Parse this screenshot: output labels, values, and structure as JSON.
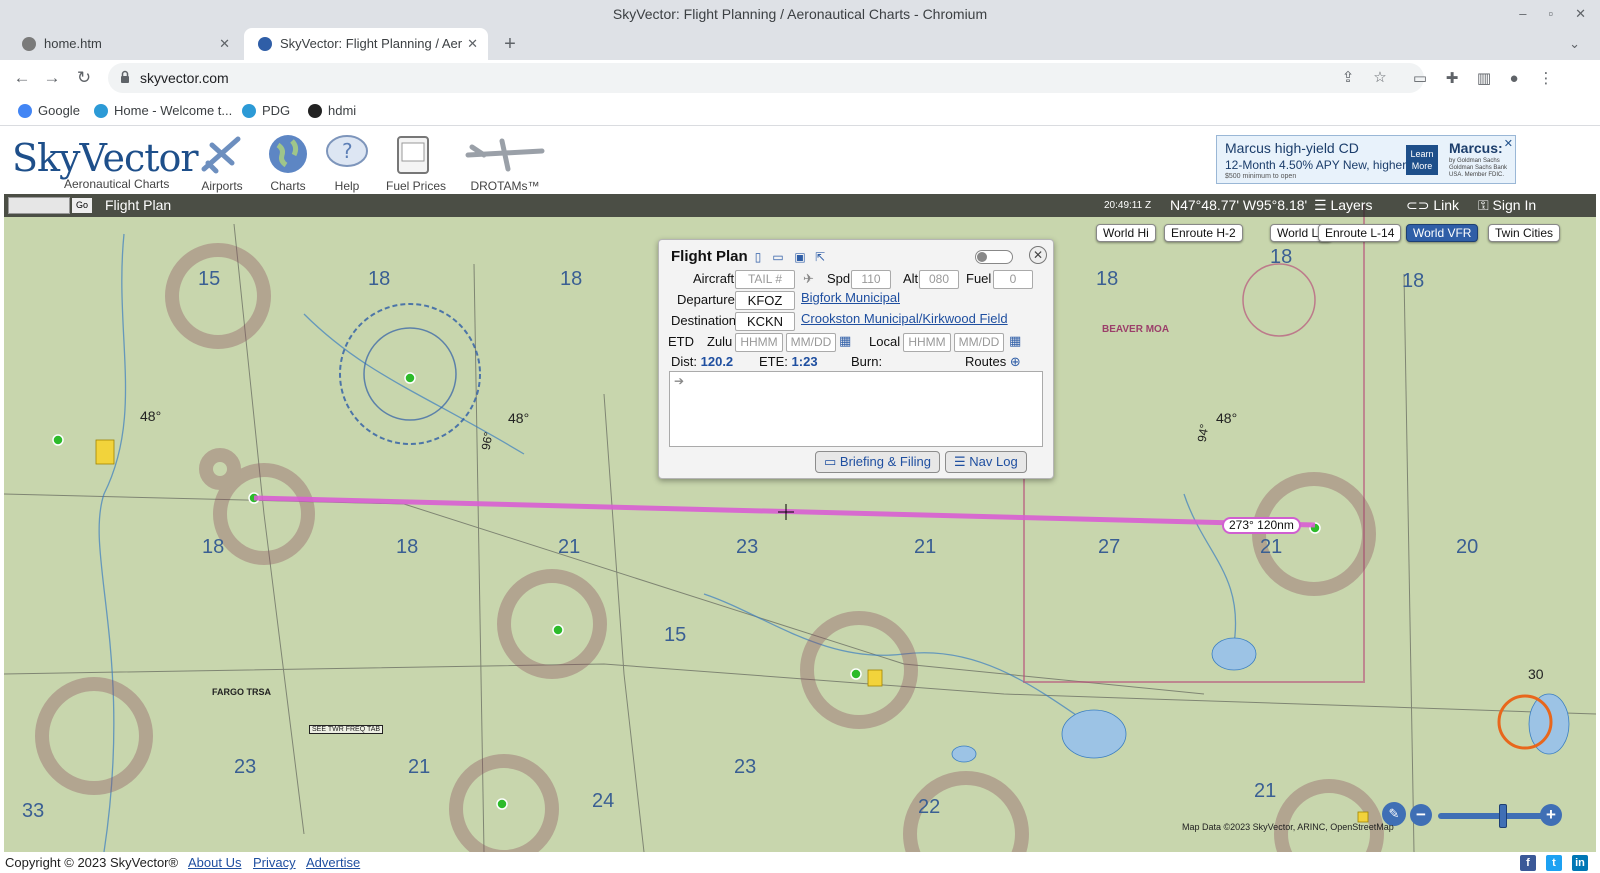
{
  "window": {
    "title": "SkyVector: Flight Planning / Aeronautical Charts - Chromium"
  },
  "tabs": [
    {
      "label": "home.htm"
    },
    {
      "label": "SkyVector: Flight Planning / Aer"
    }
  ],
  "address": {
    "url": "skyvector.com"
  },
  "bookmarks": [
    {
      "label": "Google"
    },
    {
      "label": "Home - Welcome t..."
    },
    {
      "label": "PDG"
    },
    {
      "label": "hdmi"
    }
  ],
  "site": {
    "logo": "SkyVector",
    "logo_tagline": "Aeronautical Charts",
    "nav": [
      {
        "label": "Airports",
        "icon": "airplane-icon"
      },
      {
        "label": "Charts",
        "icon": "globe-icon"
      },
      {
        "label": "Help",
        "icon": "help-icon"
      },
      {
        "label": "Fuel Prices",
        "icon": "fuel-icon"
      },
      {
        "label": "DROTAMs™",
        "icon": "drone-icon"
      }
    ],
    "ad": {
      "brand": "Marcus high-yield CD",
      "apy": "12-Month 4.50% APY New, higher rate!",
      "minimum": "$500 minimum to open",
      "cta": "Learn More",
      "logo": "Marcus:",
      "logo_sub": "by Goldman Sachs Goldman Sachs Bank USA. Member FDIC."
    }
  },
  "map_bar": {
    "go": "Go",
    "flight_plan": "Flight Plan",
    "zulu_time": "20:49:11 Z",
    "coordinates": "N47°48.77' W95°8.18'",
    "layers": "Layers",
    "link": "Link",
    "sign_in": "Sign In"
  },
  "chart_buttons": [
    {
      "label": "World Hi",
      "active": false
    },
    {
      "label": "Enroute H-2",
      "active": false
    },
    {
      "label": "World Lo",
      "active": false
    },
    {
      "label": "Enroute L-14",
      "active": false
    },
    {
      "label": "World VFR",
      "active": true
    },
    {
      "label": "Twin Cities",
      "active": false
    }
  ],
  "flight_plan": {
    "title": "Flight Plan",
    "aircraft_label": "Aircraft",
    "aircraft_placeholder": "TAIL #",
    "spd_label": "Spd",
    "spd_placeholder": "110",
    "alt_label": "Alt",
    "alt_placeholder": "080",
    "fuel_label": "Fuel",
    "fuel_placeholder": "0",
    "departure_label": "Departure",
    "departure_code": "KFOZ",
    "departure_name": "Bigfork Municipal",
    "destination_label": "Destination",
    "destination_code": "KCKN",
    "destination_name": "Crookston Municipal/Kirkwood Field",
    "etd_label": "ETD",
    "zulu_label": "Zulu",
    "local_label": "Local",
    "time_placeholder": "HHMM",
    "date_placeholder": "MM/DD",
    "dist_label": "Dist:",
    "dist_value": "120.2",
    "ete_label": "ETE:",
    "ete_value": "1:23",
    "burn_label": "Burn:",
    "routes_label": "Routes",
    "briefing_button": "Briefing & Filing",
    "navlog_button": "Nav Log"
  },
  "route_label": "273° 120nm",
  "map_labels": {
    "beaver_moa": "BEAVER MOA",
    "fargo_trsa": "FARGO TRSA",
    "see_twr": "SEE TWR FREQ TAB",
    "lat_48_a": "48°",
    "lat_48_b": "48°",
    "lat_48_c": "48°",
    "lon_96": "96°",
    "lon_94": "94°",
    "grid_numbers": [
      "15",
      "18",
      "18",
      "18",
      "21",
      "23",
      "21",
      "27",
      "21",
      "20",
      "18",
      "18",
      "18",
      "21",
      "23",
      "21",
      "15",
      "18",
      "23",
      "24",
      "22",
      "33",
      "30"
    ],
    "credit": "Map Data ©2023 SkyVector, ARINC, OpenStreetMap"
  },
  "footer": {
    "copyright": "Copyright © 2023 SkyVector®",
    "links": [
      "About Us",
      "Privacy",
      "Advertise"
    ]
  },
  "colors": {
    "route": "#d95fd3",
    "accent": "#2f5ea7",
    "map_bg": "#c8d6ad"
  }
}
